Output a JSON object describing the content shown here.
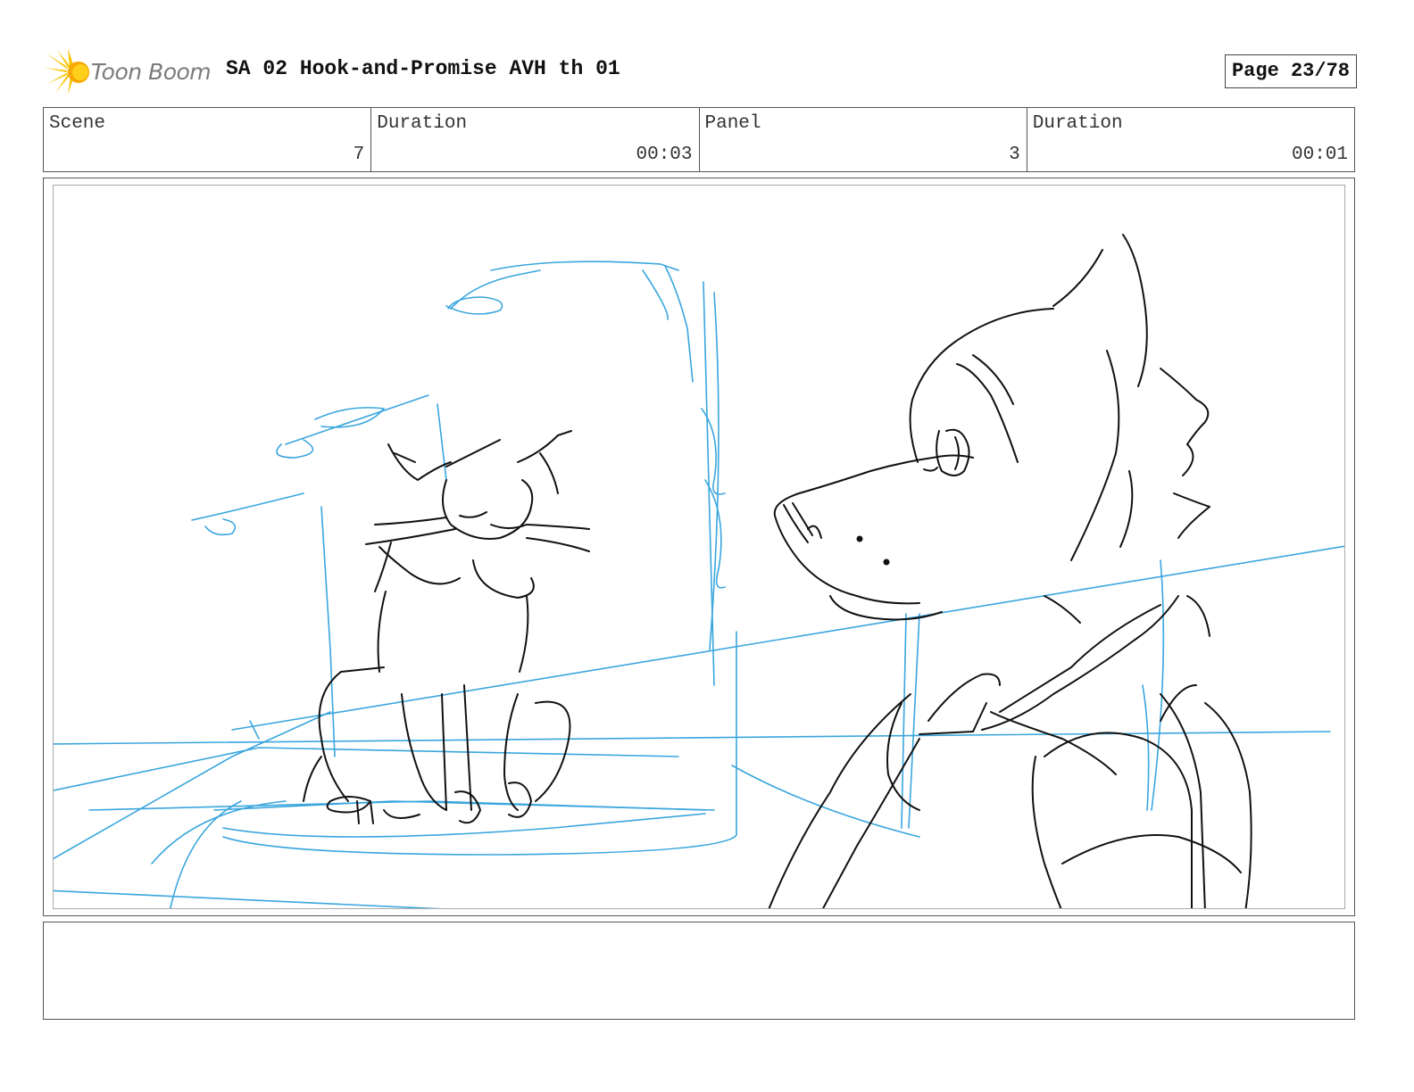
{
  "header": {
    "logo_text": "Toon Boom",
    "title": "SA 02 Hook-and-Promise AVH th 01",
    "page": "Page 23/78"
  },
  "info": [
    {
      "label": "Scene",
      "value": "7"
    },
    {
      "label": "Duration",
      "value": "00:03"
    },
    {
      "label": "Panel",
      "value": "3"
    },
    {
      "label": "Duration",
      "value": "00:01"
    }
  ],
  "panel": {
    "image": "storyboard-sketch-cat-and-dog",
    "rough_color": "#3aa6dd",
    "line_color": "#111111"
  },
  "notes": {
    "text": ""
  }
}
